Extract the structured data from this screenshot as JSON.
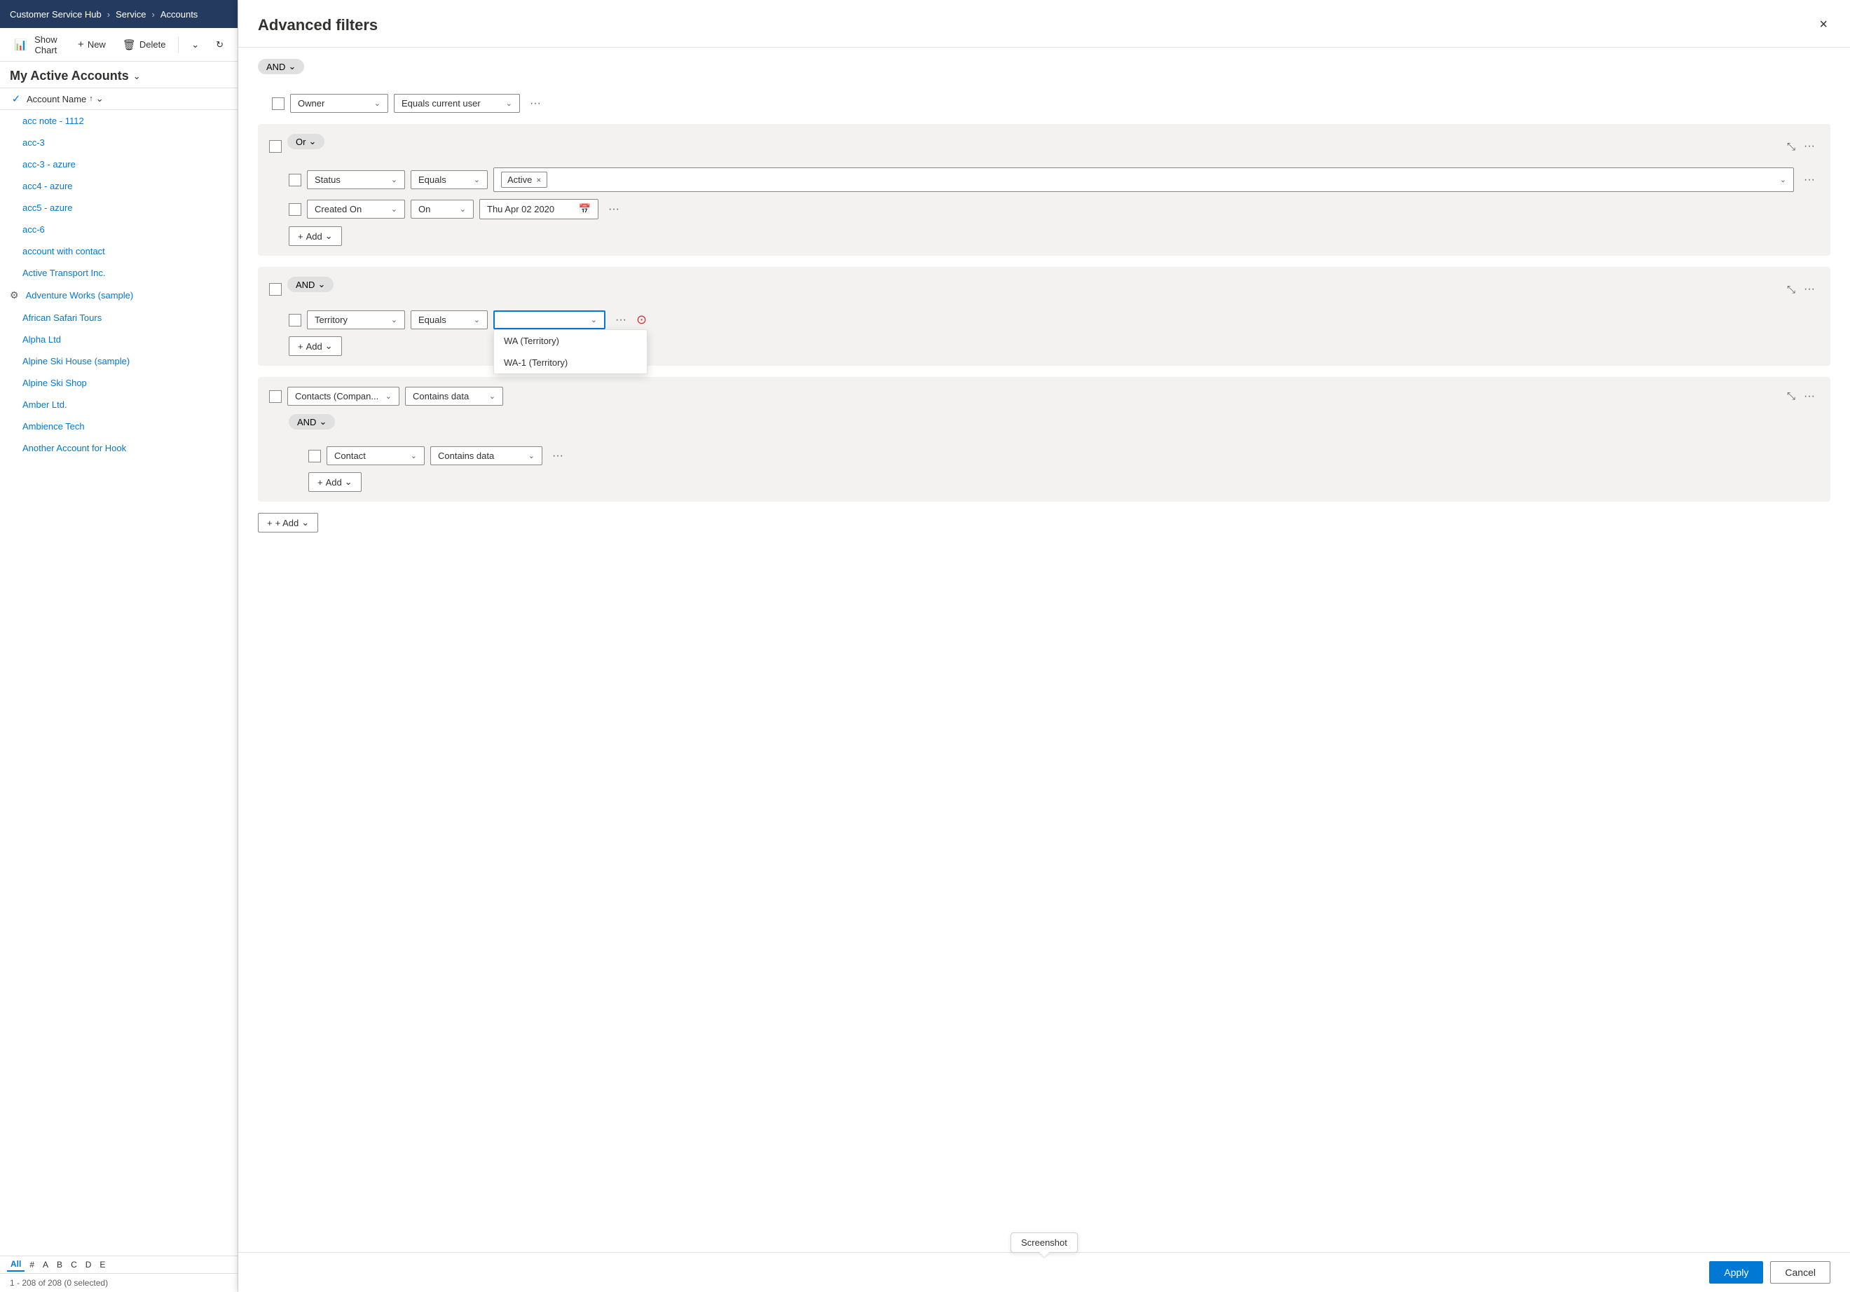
{
  "nav": {
    "app_name": "Customer Service Hub",
    "breadcrumb": [
      "Service",
      "Accounts"
    ]
  },
  "toolbar": {
    "show_chart": "Show Chart",
    "new": "New",
    "delete": "Delete"
  },
  "view": {
    "title": "My Active Accounts",
    "col_name": "Account Name",
    "sort_asc": "↑",
    "col_chevron": "⌄"
  },
  "accounts": [
    {
      "name": "acc note - 1112",
      "icon": false
    },
    {
      "name": "acc-3",
      "icon": false
    },
    {
      "name": "acc-3 - azure",
      "icon": false
    },
    {
      "name": "acc4 - azure",
      "icon": false
    },
    {
      "name": "acc5 - azure",
      "icon": false
    },
    {
      "name": "acc-6",
      "icon": false
    },
    {
      "name": "account with contact",
      "icon": false
    },
    {
      "name": "Active Transport Inc.",
      "icon": false
    },
    {
      "name": "Adventure Works (sample)",
      "icon": true
    },
    {
      "name": "African Safari Tours",
      "icon": false
    },
    {
      "name": "Alpha Ltd",
      "icon": false
    },
    {
      "name": "Alpine Ski House (sample)",
      "icon": false
    },
    {
      "name": "Alpine Ski Shop",
      "icon": false
    },
    {
      "name": "Amber Ltd.",
      "icon": false
    },
    {
      "name": "Ambience Tech",
      "icon": false
    },
    {
      "name": "Another Account for Hook",
      "icon": false
    }
  ],
  "alpha_nav": [
    "All",
    "#",
    "A",
    "B",
    "C",
    "D",
    "E"
  ],
  "alpha_active": "All",
  "pagination": "1 - 208 of 208 (0 selected)",
  "modal": {
    "title": "Advanced filters",
    "close_label": "×",
    "top_operator": "AND"
  },
  "filters": {
    "root_row": {
      "field": "Owner",
      "operator": "Equals current user"
    },
    "group1": {
      "operator": "Or",
      "rows": [
        {
          "field": "Status",
          "operator": "Equals",
          "value": "Active"
        },
        {
          "field": "Created On",
          "operator": "On",
          "value": "Thu Apr 02 2020"
        }
      ],
      "add_label": "+ Add"
    },
    "group2": {
      "operator": "AND",
      "rows": [
        {
          "field": "Territory",
          "operator": "Equals",
          "value": "",
          "dropdown_options": [
            "WA (Territory)",
            "WA-1 (Territory)"
          ]
        }
      ],
      "add_label": "+ Add"
    },
    "group3": {
      "field": "Contacts (Compan...",
      "operator": "Contains data",
      "inner_operator": "AND",
      "inner_rows": [
        {
          "field": "Contact",
          "operator": "Contains data"
        }
      ],
      "add_label": "+ Add"
    }
  },
  "root_add_label": "+ Add",
  "buttons": {
    "apply": "Apply",
    "cancel": "Cancel",
    "screenshot": "Screenshot"
  }
}
